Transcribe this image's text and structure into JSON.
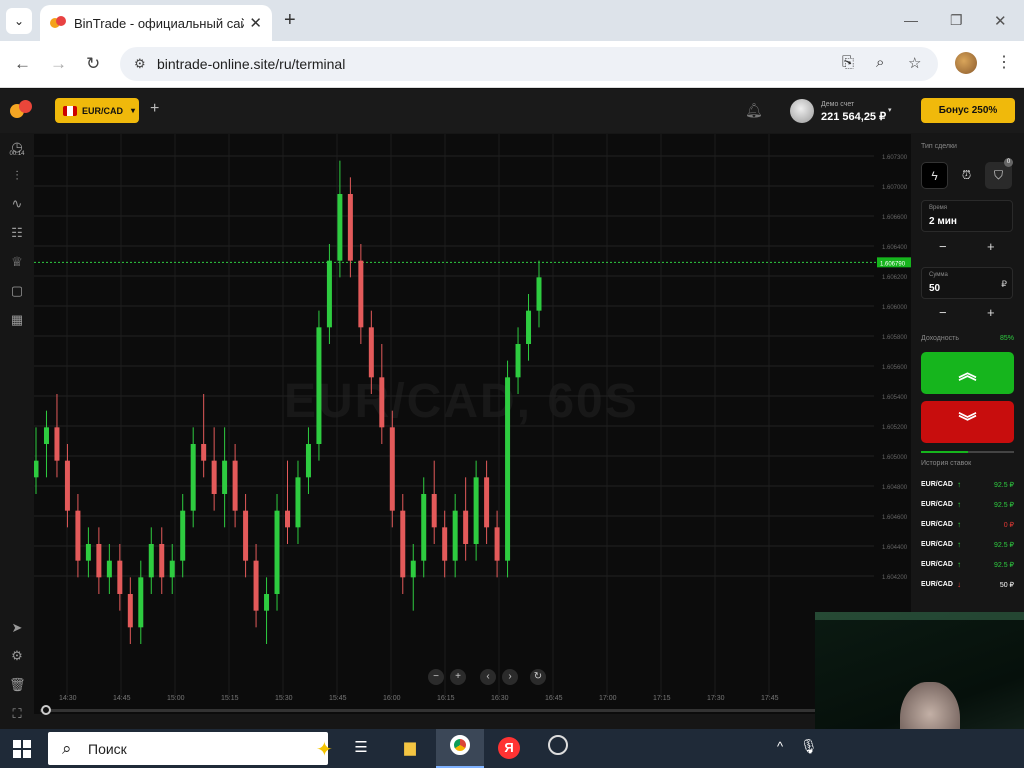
{
  "browser": {
    "tab_title": "BinTrade - официальный сайт.",
    "url": "bintrade-online.site/ru/terminal",
    "icons": {
      "tab_menu": "chevron-down-icon",
      "close": "close-icon",
      "new_tab": "plus-icon",
      "back": "arrow-left-icon",
      "forward": "arrow-right-icon",
      "reload": "reload-icon",
      "install": "install-app-icon",
      "zoom": "zoom-icon",
      "bookmark": "star-icon",
      "menu": "kebab-icon"
    }
  },
  "header": {
    "pair": "EUR/CAD",
    "account_label": "Демо счет",
    "balance": "221 564,25 ₽",
    "bonus_label": "Бонус 250%"
  },
  "rail": {
    "clock_time": "00:14"
  },
  "chart": {
    "watermark": "EUR/CAD, 60S",
    "current_price": "1.606790"
  },
  "chart_data": {
    "type": "candlestick",
    "title": "EUR/CAD, 60S",
    "y_ticks": [
      "1.607300",
      "1.607000",
      "1.606600",
      "1.606400",
      "1.606200",
      "1.606000",
      "1.605800",
      "1.605600",
      "1.605400",
      "1.605200",
      "1.605000",
      "1.604800",
      "1.604600",
      "1.604400",
      "1.604200"
    ],
    "x_ticks": [
      "14:30",
      "14:45",
      "15:00",
      "15:15",
      "15:30",
      "15:45",
      "16:00",
      "16:15",
      "16:30",
      "16:45",
      "17:00",
      "17:15",
      "17:30",
      "17:45"
    ],
    "current_price": 1.60679,
    "ylim": [
      1.6042,
      1.6075
    ],
    "candles": [
      [
        1.6056,
        1.6058,
        1.6054,
        1.6055,
        "up"
      ],
      [
        1.6057,
        1.6059,
        1.6055,
        1.6058,
        "up"
      ],
      [
        1.6058,
        1.606,
        1.6055,
        1.6056,
        "down"
      ],
      [
        1.6056,
        1.6057,
        1.6052,
        1.6053,
        "down"
      ],
      [
        1.6053,
        1.6054,
        1.6049,
        1.605,
        "down"
      ],
      [
        1.605,
        1.6052,
        1.6049,
        1.6051,
        "up"
      ],
      [
        1.6051,
        1.6052,
        1.6048,
        1.6049,
        "down"
      ],
      [
        1.6049,
        1.6051,
        1.6048,
        1.605,
        "up"
      ],
      [
        1.605,
        1.6051,
        1.6047,
        1.6048,
        "down"
      ],
      [
        1.6048,
        1.6049,
        1.6045,
        1.6046,
        "down"
      ],
      [
        1.6046,
        1.605,
        1.6045,
        1.6049,
        "up"
      ],
      [
        1.6049,
        1.6052,
        1.6048,
        1.6051,
        "up"
      ],
      [
        1.6051,
        1.6052,
        1.6048,
        1.6049,
        "down"
      ],
      [
        1.6049,
        1.6051,
        1.6048,
        1.605,
        "up"
      ],
      [
        1.605,
        1.6054,
        1.6049,
        1.6053,
        "up"
      ],
      [
        1.6053,
        1.6058,
        1.6052,
        1.6057,
        "up"
      ],
      [
        1.6057,
        1.606,
        1.6055,
        1.6056,
        "down"
      ],
      [
        1.6056,
        1.6058,
        1.6053,
        1.6054,
        "down"
      ],
      [
        1.6054,
        1.6058,
        1.6052,
        1.6056,
        "up"
      ],
      [
        1.6056,
        1.6057,
        1.6052,
        1.6053,
        "down"
      ],
      [
        1.6053,
        1.6054,
        1.6049,
        1.605,
        "down"
      ],
      [
        1.605,
        1.6051,
        1.6046,
        1.6047,
        "down"
      ],
      [
        1.6047,
        1.6049,
        1.6045,
        1.6048,
        "up"
      ],
      [
        1.6048,
        1.6054,
        1.6047,
        1.6053,
        "up"
      ],
      [
        1.6053,
        1.6056,
        1.6051,
        1.6052,
        "down"
      ],
      [
        1.6052,
        1.6056,
        1.6051,
        1.6055,
        "up"
      ],
      [
        1.6055,
        1.6058,
        1.6054,
        1.6057,
        "up"
      ],
      [
        1.6057,
        1.6065,
        1.6056,
        1.6064,
        "up"
      ],
      [
        1.6064,
        1.6069,
        1.6063,
        1.6068,
        "up"
      ],
      [
        1.6068,
        1.6074,
        1.6067,
        1.6072,
        "up"
      ],
      [
        1.6072,
        1.6073,
        1.6067,
        1.6068,
        "down"
      ],
      [
        1.6068,
        1.6069,
        1.6063,
        1.6064,
        "down"
      ],
      [
        1.6064,
        1.6065,
        1.606,
        1.6061,
        "down"
      ],
      [
        1.6061,
        1.6063,
        1.6057,
        1.6058,
        "down"
      ],
      [
        1.6058,
        1.6059,
        1.6052,
        1.6053,
        "down"
      ],
      [
        1.6053,
        1.6054,
        1.6048,
        1.6049,
        "down"
      ],
      [
        1.6049,
        1.6051,
        1.6047,
        1.605,
        "up"
      ],
      [
        1.605,
        1.6055,
        1.6049,
        1.6054,
        "up"
      ],
      [
        1.6054,
        1.6056,
        1.6051,
        1.6052,
        "down"
      ],
      [
        1.6052,
        1.6053,
        1.6049,
        1.605,
        "down"
      ],
      [
        1.605,
        1.6054,
        1.6049,
        1.6053,
        "up"
      ],
      [
        1.6053,
        1.6055,
        1.605,
        1.6051,
        "down"
      ],
      [
        1.6051,
        1.6056,
        1.605,
        1.6055,
        "up"
      ],
      [
        1.6055,
        1.6056,
        1.6051,
        1.6052,
        "down"
      ],
      [
        1.6052,
        1.6053,
        1.6049,
        1.605,
        "down"
      ],
      [
        1.605,
        1.6062,
        1.6049,
        1.6061,
        "up"
      ],
      [
        1.6061,
        1.6064,
        1.606,
        1.6063,
        "up"
      ],
      [
        1.6063,
        1.6066,
        1.6062,
        1.6065,
        "up"
      ],
      [
        1.6065,
        1.6068,
        1.6064,
        1.6067,
        "up"
      ]
    ]
  },
  "chart_controls": {
    "zoom_out": "−",
    "zoom_in": "+",
    "prev": "‹",
    "next": "›",
    "reset": "↻"
  },
  "panel": {
    "trade_type_label": "Тип сделки",
    "tt_badge": "0",
    "time_label": "Время",
    "time_value": "2 мин",
    "amount_label": "Сумма",
    "amount_value": "50",
    "currency": "₽",
    "minus": "−",
    "plus": "+",
    "payout_label": "Доходность",
    "payout_value": "85%",
    "sentiment_up": 0.5,
    "history_label": "История ставок",
    "history": [
      {
        "pair": "EUR/CAD",
        "dir": "↑",
        "value": "92.5 ₽",
        "color": "#2ecc40"
      },
      {
        "pair": "EUR/CAD",
        "dir": "↑",
        "value": "92.5 ₽",
        "color": "#2ecc40"
      },
      {
        "pair": "EUR/CAD",
        "dir": "↑",
        "value": "0 ₽",
        "color": "#e53935"
      },
      {
        "pair": "EUR/CAD",
        "dir": "↑",
        "value": "92.5 ₽",
        "color": "#2ecc40"
      },
      {
        "pair": "EUR/CAD",
        "dir": "↑",
        "value": "92.5 ₽",
        "color": "#2ecc40"
      },
      {
        "pair": "EUR/CAD",
        "dir": "↓",
        "value": "50 ₽",
        "color": "#ffffff"
      }
    ]
  },
  "taskbar": {
    "search_placeholder": "Поиск"
  }
}
